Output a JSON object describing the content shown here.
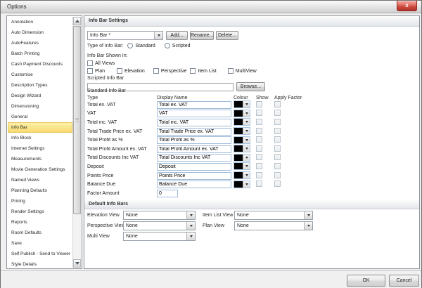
{
  "window": {
    "title": "Options",
    "close": "x"
  },
  "sidebar": {
    "selected_index": 10,
    "items": [
      "Annotation",
      "Auto Dimension",
      "AutoFeatures",
      "Batch Printing",
      "Cash Payment Discounts",
      "Customise",
      "Description Types",
      "Design Wizard",
      "Dimensioning",
      "General",
      "Info Bar",
      "Info Block",
      "Internet Settings",
      "Measurements",
      "Movie Generation Settings",
      "Named Views",
      "Planning Defaults",
      "Pricing",
      "Render Settings",
      "Reports",
      "Room Defaults",
      "Save",
      "Self Publish - Send to Viewer",
      "Style Details"
    ]
  },
  "panel": {
    "header": "Info Bar Settings",
    "infobar_combo": {
      "value": "Info Bar *"
    },
    "actions": {
      "add": "Add...",
      "rename": "Rename...",
      "delete": "Delete..."
    },
    "type_of_info_bar": {
      "label": "Type of Info Bar:",
      "options": [
        "Standard",
        "Scripted"
      ]
    },
    "shown_in": {
      "label": "Info Bar Shown In:",
      "all_views": "All Views",
      "views": [
        "Plan",
        "Elevation",
        "Perspective",
        "Item List",
        "MultiView"
      ]
    },
    "scripted_info_bar": {
      "label": "Scripted Info Bar",
      "value": "",
      "browse": "Browse..."
    },
    "standard_info_bar": {
      "label": "Standard Info Bar",
      "columns": [
        "Type",
        "Display Name",
        "Colour",
        "Show",
        "Apply Factor"
      ],
      "colour_value": "#000000",
      "rows": [
        {
          "type": "Total ex. VAT",
          "display": "Total ex. VAT"
        },
        {
          "type": "VAT",
          "display": "VAT"
        },
        {
          "type": "Total inc. VAT",
          "display": "Total inc. VAT"
        },
        {
          "type": "Total Trade Price ex. VAT",
          "display": "Total Trade Price ex. VAT"
        },
        {
          "type": "Total Profit as %",
          "display": "Total Profit as %"
        },
        {
          "type": "Total Profit Amount ex. VAT",
          "display": "Total Profit Amount ex. VAT"
        },
        {
          "type": "Total Discounts Inc VAT",
          "display": "Total Discounts Inc VAT"
        },
        {
          "type": "Deposit",
          "display": "Deposit"
        },
        {
          "type": "Points Price",
          "display": "Points Price"
        },
        {
          "type": "Balance Due",
          "display": "Balance Due"
        }
      ],
      "factor": {
        "label": "Factor Amount",
        "value": "0"
      }
    },
    "default_info_bars": {
      "header": "Default Info Bars",
      "rows": [
        {
          "left_label": "Elevation View",
          "left_value": "None",
          "right_label": "Item List View",
          "right_value": "None"
        },
        {
          "left_label": "Perspective View",
          "left_value": "None",
          "right_label": "Plan View",
          "right_value": "None"
        },
        {
          "left_label": "Multi View",
          "left_value": "None"
        }
      ]
    }
  },
  "footer": {
    "ok": "OK",
    "cancel": "Cancel"
  }
}
